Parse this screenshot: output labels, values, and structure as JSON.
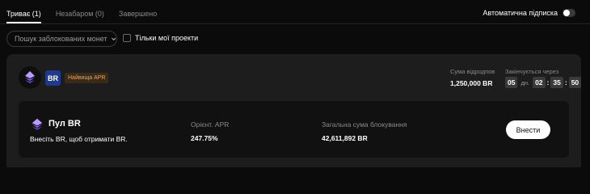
{
  "tabs": [
    {
      "label": "Триває (1)",
      "active": true
    },
    {
      "label": "Незабаром (0)",
      "active": false
    },
    {
      "label": "Завершено",
      "active": false
    }
  ],
  "auto_subscribe": {
    "label": "Автоматична підписка",
    "enabled": false
  },
  "filters": {
    "search_dropdown": "Пошук заблокованих монет",
    "only_mine_label": "Тільки мої проекти",
    "only_mine_checked": false
  },
  "project": {
    "token_badge": "BR",
    "apr_tag": "Найвища APR",
    "rewards_label": "Сума відродпов",
    "rewards_value": "1,250,000 BR",
    "ends_label": "Закінчується через",
    "countdown": {
      "days": "05",
      "days_unit": "дн.",
      "hours": "02",
      "minutes": "35",
      "seconds": "50",
      "separator": ":"
    }
  },
  "pool": {
    "title": "Пул BR",
    "description": "Внесіть BR, щоб отримати BR.",
    "apr_label": "Орієнт. APR",
    "apr_value": "247.75%",
    "total_label": "Загальна сума блокування",
    "total_value": "42,611,892 BR",
    "deposit_button": "Внести"
  },
  "colors": {
    "background": "#0b0b0b",
    "card": "#1d1d1d",
    "pool_card": "#111111",
    "apr_tag_text": "#f0a35a",
    "br_badge": "#1f3a8a"
  }
}
